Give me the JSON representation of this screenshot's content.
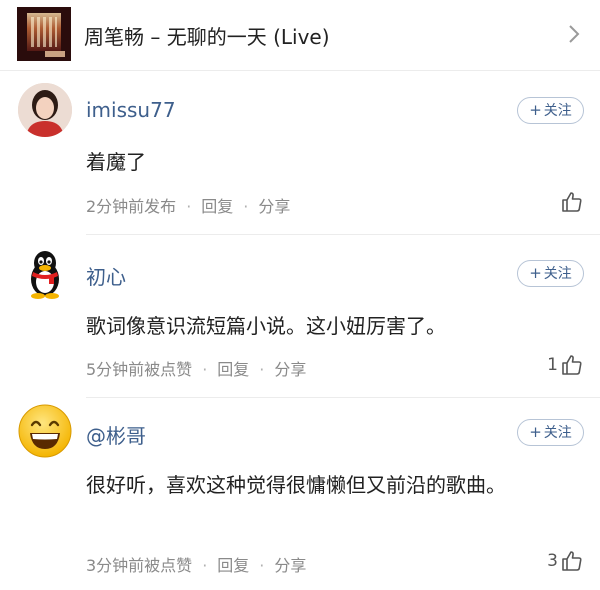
{
  "header": {
    "song_title": "周笔畅 – 无聊的一天 (Live)"
  },
  "comments": [
    {
      "username": "imissu77",
      "text": "着魔了",
      "time": "2分钟前发布",
      "reply": "回复",
      "share": "分享",
      "follow_label": "关注",
      "likes": ""
    },
    {
      "username": "初心",
      "text": "歌词像意识流短篇小说。这小妞厉害了。",
      "time": "5分钟前被点赞",
      "reply": "回复",
      "share": "分享",
      "follow_label": "关注",
      "likes": "1"
    },
    {
      "username": "@彬哥",
      "text": "很好听，喜欢这种觉得很慵懒但又前沿的歌曲。",
      "time": "3分钟前被点赞",
      "reply": "回复",
      "share": "分享",
      "follow_label": "关注",
      "likes": "3"
    }
  ],
  "colors": {
    "username": "#3e5f8c",
    "meta": "#8a8a8a",
    "follow_border": "#b7c4d6"
  }
}
